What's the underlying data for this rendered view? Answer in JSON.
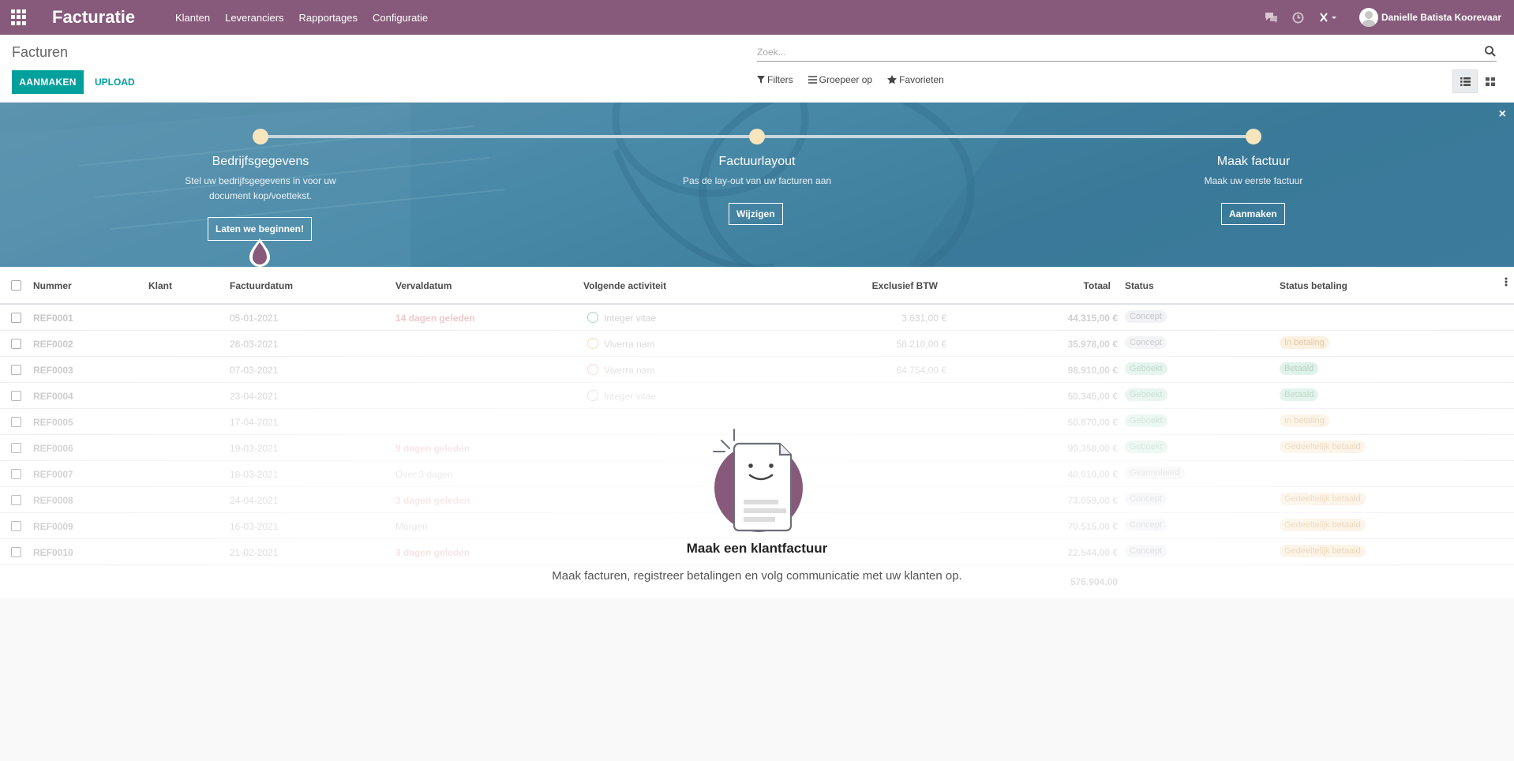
{
  "navbar": {
    "app_title": "Facturatie",
    "menu": [
      "Klanten",
      "Leveranciers",
      "Rapportages",
      "Configuratie"
    ],
    "user_name": "Danielle Batista Koorevaar",
    "icons": [
      "apps-grid-icon",
      "chat-icon",
      "clock-icon",
      "debug-icon",
      "avatar"
    ],
    "color": "#875a7b"
  },
  "control_panel": {
    "breadcrumb": "Facturen",
    "create_button": "AANMAKEN",
    "upload_button": "UPLOAD",
    "search_placeholder": "Zoek...",
    "filters_label": "Filters",
    "groupby_label": "Groepeer op",
    "favorites_label": "Favorieten",
    "accent_color": "#00a09d"
  },
  "onboarding": {
    "steps": [
      {
        "title": "Bedrijfsgegevens",
        "desc_line1": "Stel uw bedrijfsgegevens in voor uw",
        "desc_line2": "document kop/voettekst.",
        "button": "Laten we beginnen!"
      },
      {
        "title": "Factuurlayout",
        "desc_line1": "Pas de lay-out van uw facturen aan",
        "desc_line2": "",
        "button": "Wijzigen"
      },
      {
        "title": "Maak factuur",
        "desc_line1": "Maak uw eerste factuur",
        "desc_line2": "",
        "button": "Aanmaken"
      }
    ],
    "close": "×"
  },
  "table": {
    "headers": {
      "number": "Nummer",
      "customer": "Klant",
      "invoice_date": "Factuurdatum",
      "due_date": "Vervaldatum",
      "next_activity": "Volgende activiteit",
      "untaxed": "Exclusief BTW",
      "total": "Totaal",
      "status": "Status",
      "payment_status": "Status betaling"
    },
    "rows": [
      {
        "number": "REF0001",
        "invoice_date": "05-01-2021",
        "due_date": "14 dagen geleden",
        "activity": "Integer vitae",
        "untaxed": "3.631,00 €",
        "total": "44.315,00 €",
        "status": "Concept",
        "payment": ""
      },
      {
        "number": "REF0002",
        "invoice_date": "28-03-2021",
        "due_date": "",
        "activity": "Viverra nam",
        "untaxed": "58.210,00 €",
        "total": "35.978,00 €",
        "status": "Concept",
        "payment": "In betaling"
      },
      {
        "number": "REF0003",
        "invoice_date": "07-03-2021",
        "due_date": "",
        "activity": "Viverra nam",
        "untaxed": "64.754,00 €",
        "total": "98.910,00 €",
        "status": "Geboekt",
        "payment": "Betaald"
      },
      {
        "number": "REF0004",
        "invoice_date": "23-04-2021",
        "due_date": "",
        "activity": "Integer vitae",
        "untaxed": "",
        "total": "50.345,00 €",
        "status": "Geboekt",
        "payment": "Betaald"
      },
      {
        "number": "REF0005",
        "invoice_date": "17-04-2021",
        "due_date": "",
        "activity": "",
        "untaxed": "",
        "total": "50.870,00 €",
        "status": "Geboekt",
        "payment": "In betaling"
      },
      {
        "number": "REF0006",
        "invoice_date": "19-03-2021",
        "due_date": "9 dagen geleden",
        "activity": "",
        "untaxed": "",
        "total": "90.358,00 €",
        "status": "Geboekt",
        "payment": "Gedeeltelijk betaald"
      },
      {
        "number": "REF0007",
        "invoice_date": "18-03-2021",
        "due_date": "Over 3 dagen",
        "activity": "",
        "untaxed": "",
        "total": "40.010,00 €",
        "status": "Geannuleerd",
        "payment": ""
      },
      {
        "number": "REF0008",
        "invoice_date": "24-04-2021",
        "due_date": "3 dagen geleden",
        "activity": "",
        "untaxed": "",
        "total": "73.059,00 €",
        "status": "Concept",
        "payment": "Gedeeltelijk betaald"
      },
      {
        "number": "REF0009",
        "invoice_date": "16-03-2021",
        "due_date": "Morgen",
        "activity": "",
        "untaxed": "",
        "total": "70.515,00 €",
        "status": "Concept",
        "payment": "Gedeeltelijk betaald"
      },
      {
        "number": "REF0010",
        "invoice_date": "21-02-2021",
        "due_date": "3 dagen geleden",
        "activity": "",
        "untaxed": "",
        "total": "22.544,00 €",
        "status": "Concept",
        "payment": "Gedeeltelijk betaald"
      }
    ],
    "grand_total": "576.904,00"
  },
  "empty_helper": {
    "title": "Maak een klantfactuur",
    "description": "Maak facturen, registreer betalingen en volg communicatie met uw klanten op."
  }
}
